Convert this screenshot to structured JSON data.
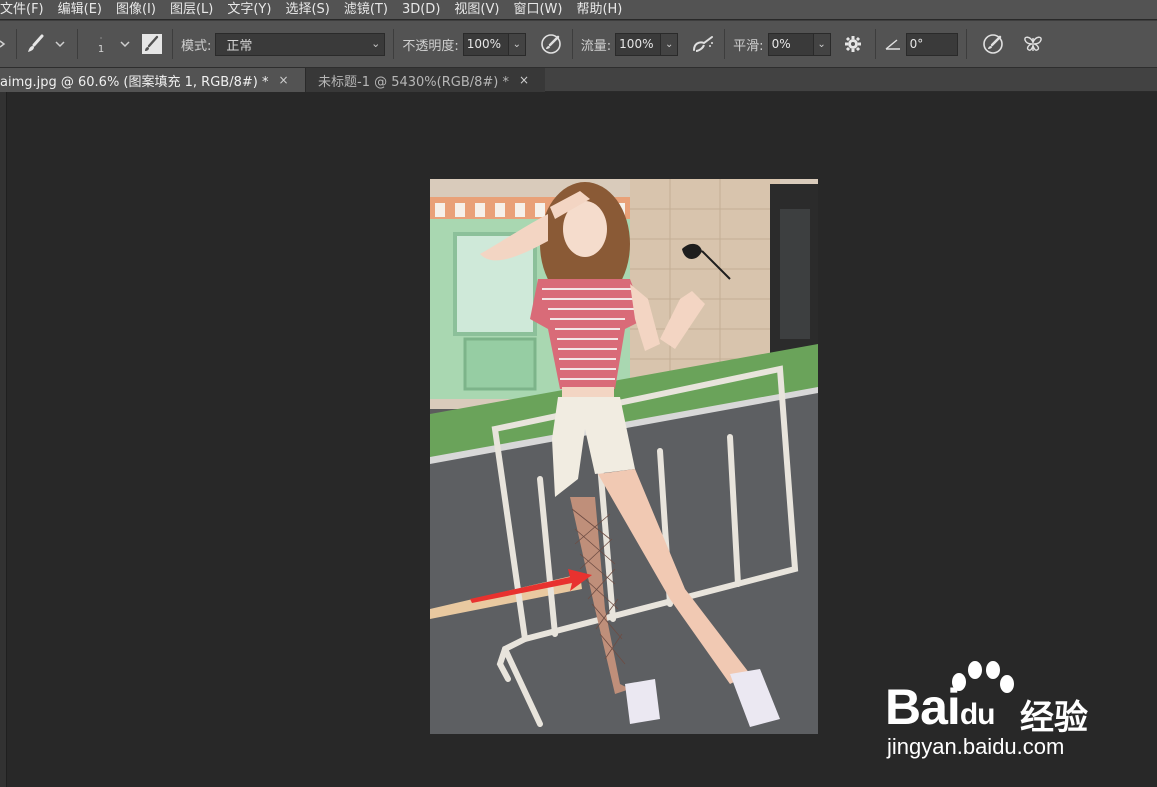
{
  "menubar": {
    "items": [
      "文件(F)",
      "编辑(E)",
      "图像(I)",
      "图层(L)",
      "文字(Y)",
      "选择(S)",
      "滤镜(T)",
      "3D(D)",
      "视图(V)",
      "窗口(W)",
      "帮助(H)"
    ]
  },
  "options": {
    "brush_size": "1",
    "mode_label": "模式:",
    "mode_value": "正常",
    "opacity_label": "不透明度:",
    "opacity_value": "100%",
    "flow_label": "流量:",
    "flow_value": "100%",
    "smooth_label": "平滑:",
    "smooth_value": "0%",
    "angle_value": "0°"
  },
  "tabs": [
    {
      "label": "aimg.jpg @ 60.6% (图案填充 1, RGB/8#) *",
      "close": "×"
    },
    {
      "label": "未标题-1 @ 5430%(RGB/8#) *",
      "close": "×"
    }
  ],
  "watermark": {
    "brand": "Bai",
    "brand_du": "du",
    "cn": "经验",
    "url": "jingyan.baidu.com"
  },
  "colors": {
    "panel": "#535353",
    "workspace": "#282828",
    "arrow": "#e8322f"
  }
}
